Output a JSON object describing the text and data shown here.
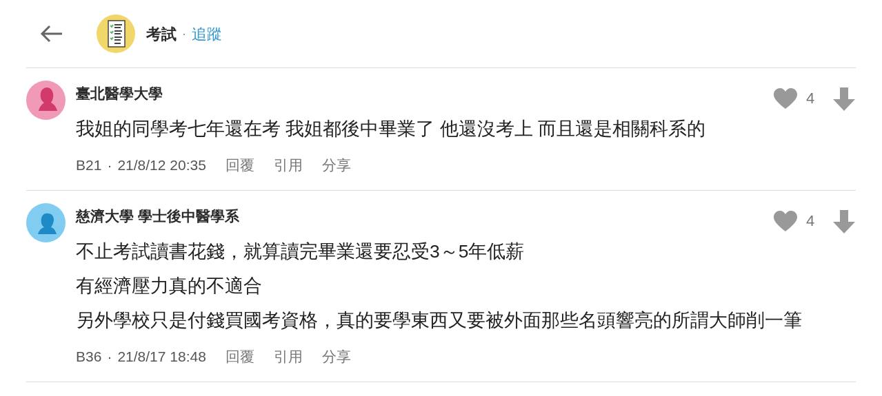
{
  "header": {
    "board": "考試",
    "separator": "·",
    "follow": "追蹤"
  },
  "comments": [
    {
      "kind": "female",
      "author": "臺北醫學大學",
      "lines": [
        "我姐的同學考七年還在考 我姐都後中畢業了 他還沒考上 而且還是相關科系的"
      ],
      "likes": "4",
      "floor": "B21",
      "dot": "·",
      "time": "21/8/12 20:35",
      "actions": [
        "回覆",
        "引用",
        "分享"
      ]
    },
    {
      "kind": "male",
      "author": "慈濟大學 學士後中醫學系",
      "lines": [
        "不止考試讀書花錢，就算讀完畢業還要忍受3～5年低薪",
        "有經濟壓力真的不適合",
        "另外學校只是付錢買國考資格，真的要學東西又要被外面那些名頭響亮的所謂大師削一筆"
      ],
      "likes": "4",
      "floor": "B36",
      "dot": "·",
      "time": "21/8/17 18:48",
      "actions": [
        "回覆",
        "引用",
        "分享"
      ]
    }
  ]
}
